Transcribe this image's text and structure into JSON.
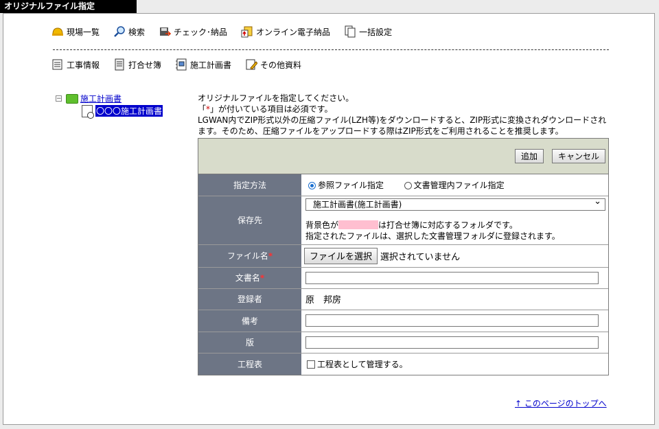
{
  "window": {
    "title": "オリジナルファイル指定"
  },
  "nav_top": [
    {
      "label": "現場一覧",
      "icon": "helmet-icon"
    },
    {
      "label": "検索",
      "icon": "magnifier-icon"
    },
    {
      "label": "チェック･納品",
      "icon": "disk-icon"
    },
    {
      "label": "オンライン電子納品",
      "icon": "upload-icon"
    },
    {
      "label": "一括設定",
      "icon": "pages-icon"
    }
  ],
  "nav_sub": [
    {
      "label": "工事情報",
      "icon": "notepad-icon"
    },
    {
      "label": "打合せ簿",
      "icon": "sheet-icon"
    },
    {
      "label": "施工計画書",
      "icon": "binder-icon"
    },
    {
      "label": "その他資料",
      "icon": "pencil-note-icon"
    }
  ],
  "tree": {
    "toggle": "−",
    "root": "施工計画書",
    "child": "〇〇〇施工計画書"
  },
  "notes": {
    "line1": "オリジナルファイルを指定してください。",
    "line2_pre": "「",
    "line2_mark": "*",
    "line2_post": "」が付いている項目は必須です。",
    "line3": "LGWAN内でZIP形式以外の圧縮ファイル(LZH等)をダウンロードすると、ZIP形式に変換されダウンロードされます。そのため、圧縮ファイルをアップロードする際はZIP形式をご利用されることを推奨します。"
  },
  "buttons": {
    "add": "追加",
    "cancel": "キャンセル"
  },
  "form": {
    "method_label": "指定方法",
    "method_option1": "参照ファイル指定",
    "method_option2": "文書管理内ファイル指定",
    "dest_label": "保存先",
    "dest_value": "施工計画書(施工計画書)",
    "dest_note1_pre": "背景色が",
    "dest_note1_post": "は打合せ簿に対応するフォルダです。",
    "dest_note2": "指定されたファイルは、選択した文書管理フォルダに登録されます。",
    "file_label": "ファイル名",
    "file_button": "ファイルを選択",
    "file_status": "選択されていません",
    "docname_label": "文書名",
    "required_mark": "*",
    "registrant_label": "登録者",
    "registrant_value": "原　邦房",
    "remarks_label": "備考",
    "version_label": "版",
    "schedule_label": "工程表",
    "schedule_check": "工程表として管理する。"
  },
  "footer": {
    "top_link": "↑ このページのトップへ"
  },
  "colors": {
    "label_bg": "#6d7585",
    "head_bg": "#d8dccb",
    "swatch": "#ffbfd0",
    "link": "#0000cc"
  }
}
